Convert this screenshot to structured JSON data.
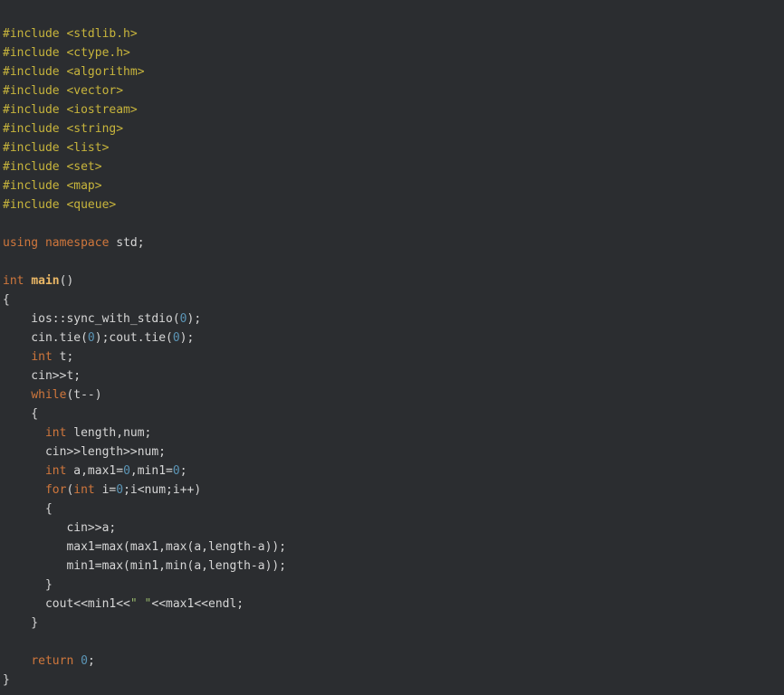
{
  "colors": {
    "background": "#2b2d30",
    "text": "#d6d6d6",
    "preprocessor": "#c8b53c",
    "keyword": "#d0773c",
    "function": "#ebb866",
    "number": "#5b95b6",
    "string": "#97b86b"
  },
  "code": {
    "lines": [
      [
        {
          "t": "pre",
          "v": "#include <stdlib.h>"
        }
      ],
      [
        {
          "t": "pre",
          "v": "#include <ctype.h>"
        }
      ],
      [
        {
          "t": "pre",
          "v": "#include <algorithm>"
        }
      ],
      [
        {
          "t": "pre",
          "v": "#include <vector>"
        }
      ],
      [
        {
          "t": "pre",
          "v": "#include <iostream>"
        }
      ],
      [
        {
          "t": "pre",
          "v": "#include <string>"
        }
      ],
      [
        {
          "t": "pre",
          "v": "#include <list>"
        }
      ],
      [
        {
          "t": "pre",
          "v": "#include <set>"
        }
      ],
      [
        {
          "t": "pre",
          "v": "#include <map>"
        }
      ],
      [
        {
          "t": "pre",
          "v": "#include <queue>"
        }
      ],
      [],
      [
        {
          "t": "kw",
          "v": "using"
        },
        {
          "t": "txt",
          "v": " "
        },
        {
          "t": "kw",
          "v": "namespace"
        },
        {
          "t": "txt",
          "v": " std;"
        }
      ],
      [],
      [
        {
          "t": "kw",
          "v": "int"
        },
        {
          "t": "txt",
          "v": " "
        },
        {
          "t": "fn",
          "v": "main"
        },
        {
          "t": "txt",
          "v": "()"
        }
      ],
      [
        {
          "t": "txt",
          "v": "{"
        }
      ],
      [
        {
          "t": "txt",
          "v": "    ios::sync_with_stdio("
        },
        {
          "t": "num",
          "v": "0"
        },
        {
          "t": "txt",
          "v": ");"
        }
      ],
      [
        {
          "t": "txt",
          "v": "    cin.tie("
        },
        {
          "t": "num",
          "v": "0"
        },
        {
          "t": "txt",
          "v": ");cout.tie("
        },
        {
          "t": "num",
          "v": "0"
        },
        {
          "t": "txt",
          "v": ");"
        }
      ],
      [
        {
          "t": "txt",
          "v": "    "
        },
        {
          "t": "kw",
          "v": "int"
        },
        {
          "t": "txt",
          "v": " t;"
        }
      ],
      [
        {
          "t": "txt",
          "v": "    cin>>t;"
        }
      ],
      [
        {
          "t": "txt",
          "v": "    "
        },
        {
          "t": "kw",
          "v": "while"
        },
        {
          "t": "txt",
          "v": "(t--)"
        }
      ],
      [
        {
          "t": "txt",
          "v": "    {"
        }
      ],
      [
        {
          "t": "txt",
          "v": "      "
        },
        {
          "t": "kw",
          "v": "int"
        },
        {
          "t": "txt",
          "v": " length,num;"
        }
      ],
      [
        {
          "t": "txt",
          "v": "      cin>>length>>num;"
        }
      ],
      [
        {
          "t": "txt",
          "v": "      "
        },
        {
          "t": "kw",
          "v": "int"
        },
        {
          "t": "txt",
          "v": " a,max1="
        },
        {
          "t": "num",
          "v": "0"
        },
        {
          "t": "txt",
          "v": ",min1="
        },
        {
          "t": "num",
          "v": "0"
        },
        {
          "t": "txt",
          "v": ";"
        }
      ],
      [
        {
          "t": "txt",
          "v": "      "
        },
        {
          "t": "kw",
          "v": "for"
        },
        {
          "t": "txt",
          "v": "("
        },
        {
          "t": "kw",
          "v": "int"
        },
        {
          "t": "txt",
          "v": " i="
        },
        {
          "t": "num",
          "v": "0"
        },
        {
          "t": "txt",
          "v": ";i<num;i++)"
        }
      ],
      [
        {
          "t": "txt",
          "v": "      {"
        }
      ],
      [
        {
          "t": "txt",
          "v": "         cin>>a;"
        }
      ],
      [
        {
          "t": "txt",
          "v": "         max1=max(max1,max(a,length-a));"
        }
      ],
      [
        {
          "t": "txt",
          "v": "         min1=max(min1,min(a,length-a));"
        }
      ],
      [
        {
          "t": "txt",
          "v": "      }"
        }
      ],
      [
        {
          "t": "txt",
          "v": "      cout<<min1<<"
        },
        {
          "t": "str",
          "v": "\" \""
        },
        {
          "t": "txt",
          "v": "<<max1<<endl;"
        }
      ],
      [
        {
          "t": "txt",
          "v": "    }"
        }
      ],
      [],
      [
        {
          "t": "txt",
          "v": "    "
        },
        {
          "t": "kw",
          "v": "return"
        },
        {
          "t": "txt",
          "v": " "
        },
        {
          "t": "num",
          "v": "0"
        },
        {
          "t": "txt",
          "v": ";"
        }
      ],
      [
        {
          "t": "txt",
          "v": "}"
        }
      ]
    ]
  }
}
